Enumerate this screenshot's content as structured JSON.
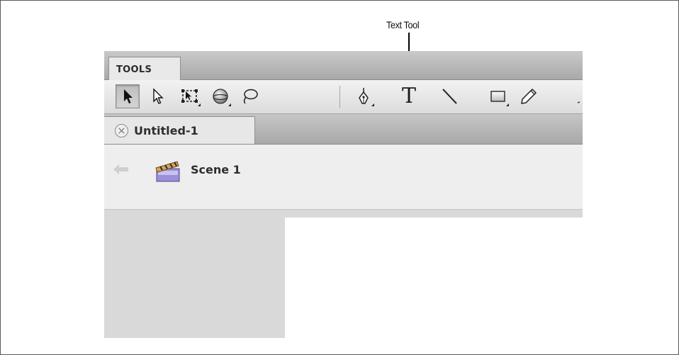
{
  "callout": {
    "label": "Text Tool"
  },
  "tools_panel": {
    "tab_label": "TOOLS",
    "tools": [
      {
        "name": "selection-tool",
        "icon": "arrow-black-icon",
        "selected": true
      },
      {
        "name": "subselection-tool",
        "icon": "arrow-white-icon",
        "selected": false
      },
      {
        "name": "free-transform-tool",
        "icon": "free-transform-icon",
        "selected": false
      },
      {
        "name": "3d-rotation-tool",
        "icon": "3d-rotation-icon",
        "selected": false
      },
      {
        "name": "lasso-tool",
        "icon": "lasso-icon",
        "selected": false
      },
      {
        "name": "pen-tool",
        "icon": "pen-icon",
        "selected": false
      },
      {
        "name": "text-tool",
        "icon": "text-t-icon",
        "glyph": "T",
        "selected": false
      },
      {
        "name": "line-tool",
        "icon": "line-icon",
        "selected": false
      },
      {
        "name": "rectangle-tool",
        "icon": "rectangle-icon",
        "selected": false
      },
      {
        "name": "pencil-tool",
        "icon": "pencil-icon",
        "selected": false
      }
    ]
  },
  "document": {
    "tab_title": "Untitled-1",
    "close_icon": "close-circle-icon"
  },
  "scene_bar": {
    "scene_label": "Scene 1",
    "back_icon": "back-arrow-icon",
    "scene_icon": "clapperboard-icon"
  },
  "colors": {
    "pasteboard": "#d9d9d9",
    "stage": "#ffffff",
    "panel_bar": "#b8b8b8"
  }
}
